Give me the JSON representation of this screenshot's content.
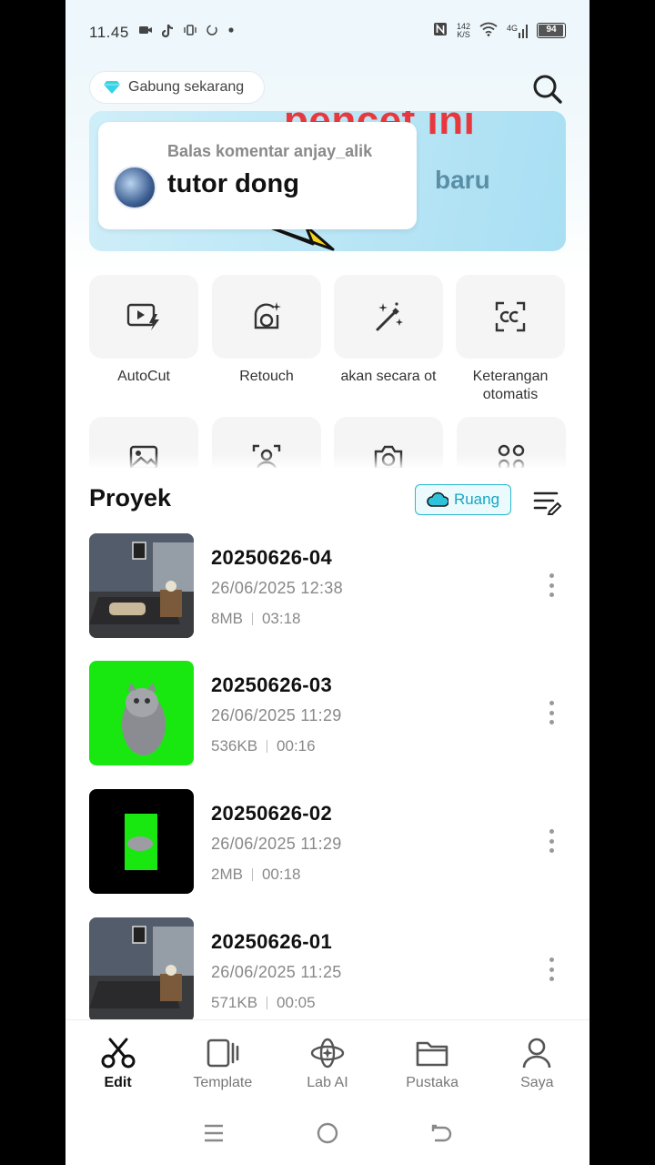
{
  "status_bar": {
    "time": "11.45",
    "network_speed_value": "142",
    "network_speed_unit": "K/S",
    "network_type": "4G",
    "battery_level": "94"
  },
  "header": {
    "join_label": "Gabung sekarang"
  },
  "banner": {
    "title": "pencet ini",
    "subtitle": "baru"
  },
  "comment": {
    "reply_label": "Balas komentar anjay_alik",
    "text": "tutor dong"
  },
  "tools": [
    {
      "label": "AutoCut",
      "icon": "autocut-icon"
    },
    {
      "label": "Retouch",
      "icon": "retouch-icon"
    },
    {
      "label": "akan secara ot",
      "icon": "magic-wand-icon"
    },
    {
      "label": "Keterangan otomatis",
      "label_line1": "Keterangan",
      "label_line2": "otomatis",
      "icon": "captions-icon"
    }
  ],
  "projects_section": {
    "title": "Proyek",
    "space_button": "Ruang"
  },
  "projects": [
    {
      "name": "20250626-04",
      "date": "26/06/2025 12:38",
      "size": "8MB",
      "duration": "03:18"
    },
    {
      "name": "20250626-03",
      "date": "26/06/2025 11:29",
      "size": "536KB",
      "duration": "00:16"
    },
    {
      "name": "20250626-02",
      "date": "26/06/2025 11:29",
      "size": "2MB",
      "duration": "00:18"
    },
    {
      "name": "20250626-01",
      "date": "26/06/2025 11:25",
      "size": "571KB",
      "duration": "00:05"
    }
  ],
  "bottom_nav": [
    {
      "label": "Edit",
      "icon": "scissors-icon",
      "active": true
    },
    {
      "label": "Template",
      "icon": "template-icon",
      "active": false
    },
    {
      "label": "Lab AI",
      "icon": "lab-ai-icon",
      "active": false
    },
    {
      "label": "Pustaka",
      "icon": "folder-icon",
      "active": false
    },
    {
      "label": "Saya",
      "icon": "person-icon",
      "active": false
    }
  ],
  "colors": {
    "accent": "#2ab7d0",
    "banner_title": "#e8383d",
    "green_screen": "#18e810"
  }
}
